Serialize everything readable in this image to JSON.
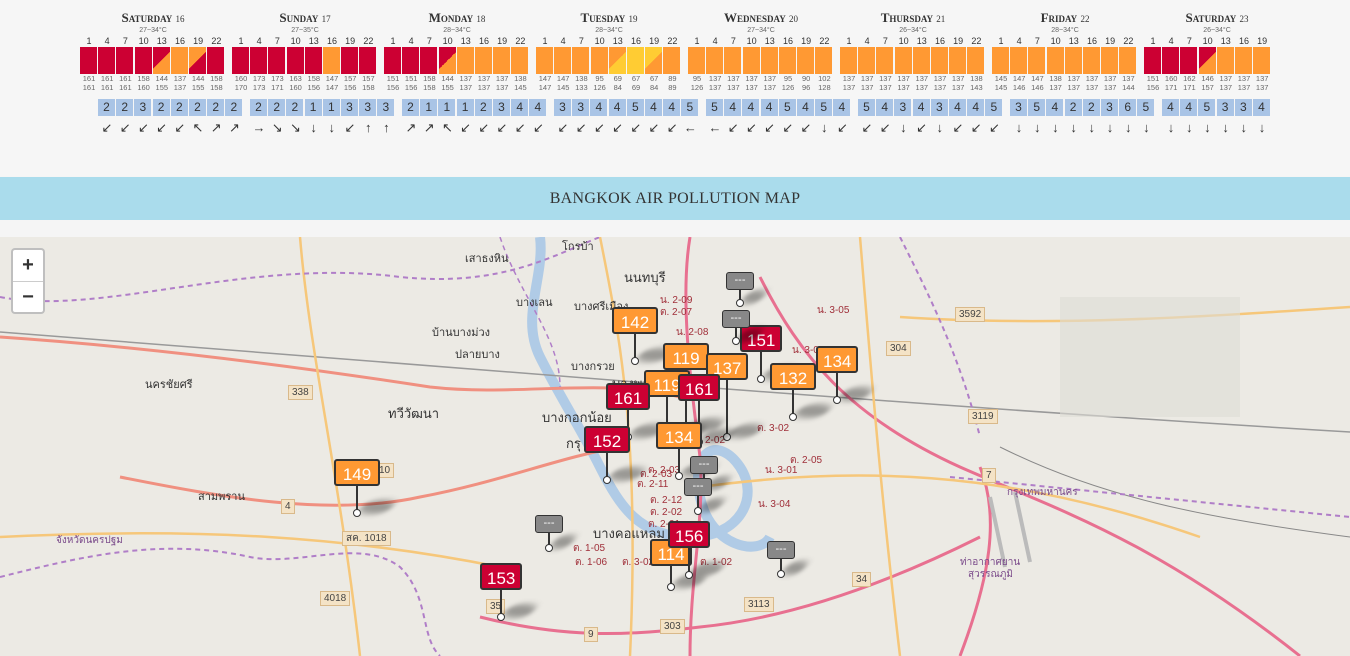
{
  "colors": {
    "red": "#cc0033",
    "orange": "#ff9933",
    "yellow": "#ffcc33",
    "gray": "#888888"
  },
  "forecast": [
    {
      "name": "Saturday",
      "num": "16",
      "temp": "27~34°C",
      "hours": [
        "1",
        "4",
        "7",
        "10",
        "13",
        "16",
        "19",
        "22"
      ],
      "cells": [
        "r",
        "r",
        "r",
        "r",
        "ro",
        "o",
        "or",
        "r"
      ],
      "v1": [
        "161",
        "161",
        "161",
        "158",
        "144",
        "137",
        "144",
        "158"
      ],
      "v2": [
        "161",
        "161",
        "161",
        "160",
        "155",
        "137",
        "155",
        "158"
      ],
      "wind": [
        "2",
        "2",
        "3",
        "2",
        "2",
        "2",
        "2",
        "2"
      ],
      "dir": [
        "↙",
        "↙",
        "↙",
        "↙",
        "↙",
        "↖",
        "↗",
        "↗"
      ]
    },
    {
      "name": "Sunday",
      "num": "17",
      "temp": "27~35°C",
      "hours": [
        "1",
        "4",
        "7",
        "10",
        "13",
        "16",
        "19",
        "22"
      ],
      "cells": [
        "r",
        "r",
        "r",
        "r",
        "r",
        "o",
        "r",
        "r"
      ],
      "v1": [
        "160",
        "173",
        "173",
        "163",
        "158",
        "147",
        "157",
        "157"
      ],
      "v2": [
        "170",
        "173",
        "171",
        "160",
        "156",
        "147",
        "156",
        "158"
      ],
      "wind": [
        "2",
        "2",
        "2",
        "1",
        "1",
        "3",
        "3",
        "3"
      ],
      "dir": [
        "→",
        "↘",
        "↘",
        "↓",
        "↓",
        "↙",
        "↑",
        "↑"
      ]
    },
    {
      "name": "Monday",
      "num": "18",
      "temp": "28~34°C",
      "hours": [
        "1",
        "4",
        "7",
        "10",
        "13",
        "16",
        "19",
        "22"
      ],
      "cells": [
        "r",
        "r",
        "r",
        "ro",
        "o",
        "o",
        "o",
        "o"
      ],
      "v1": [
        "151",
        "151",
        "158",
        "144",
        "137",
        "137",
        "137",
        "138"
      ],
      "v2": [
        "156",
        "156",
        "158",
        "155",
        "137",
        "137",
        "137",
        "145"
      ],
      "wind": [
        "2",
        "1",
        "1",
        "1",
        "2",
        "3",
        "4",
        "4"
      ],
      "dir": [
        "↗",
        "↗",
        "↖",
        "↙",
        "↙",
        "↙",
        "↙",
        "↙"
      ]
    },
    {
      "name": "Tuesday",
      "num": "19",
      "temp": "28~34°C",
      "hours": [
        "1",
        "4",
        "7",
        "10",
        "13",
        "16",
        "19",
        "22"
      ],
      "cells": [
        "o",
        "o",
        "o",
        "o",
        "oy",
        "y",
        "yo",
        "o"
      ],
      "v1": [
        "147",
        "147",
        "138",
        "95",
        "69",
        "67",
        "67",
        "89"
      ],
      "v2": [
        "147",
        "145",
        "133",
        "126",
        "84",
        "69",
        "84",
        "89"
      ],
      "wind": [
        "3",
        "3",
        "4",
        "4",
        "5",
        "4",
        "4",
        "5"
      ],
      "dir": [
        "↙",
        "↙",
        "↙",
        "↙",
        "↙",
        "↙",
        "↙",
        "←"
      ]
    },
    {
      "name": "Wednesday",
      "num": "20",
      "temp": "27~34°C",
      "hours": [
        "1",
        "4",
        "7",
        "10",
        "13",
        "16",
        "19",
        "22"
      ],
      "cells": [
        "o",
        "o",
        "o",
        "o",
        "o",
        "o",
        "o",
        "o"
      ],
      "v1": [
        "95",
        "137",
        "137",
        "137",
        "137",
        "95",
        "90",
        "102"
      ],
      "v2": [
        "126",
        "137",
        "137",
        "137",
        "137",
        "126",
        "96",
        "128"
      ],
      "wind": [
        "5",
        "4",
        "4",
        "4",
        "5",
        "4",
        "5",
        "4"
      ],
      "dir": [
        "←",
        "↙",
        "↙",
        "↙",
        "↙",
        "↙",
        "↓",
        "↙"
      ]
    },
    {
      "name": "Thursday",
      "num": "21",
      "temp": "26~34°C",
      "hours": [
        "1",
        "4",
        "7",
        "10",
        "13",
        "16",
        "19",
        "22"
      ],
      "cells": [
        "o",
        "o",
        "o",
        "o",
        "o",
        "o",
        "o",
        "o"
      ],
      "v1": [
        "137",
        "137",
        "137",
        "137",
        "137",
        "137",
        "137",
        "138"
      ],
      "v2": [
        "137",
        "137",
        "137",
        "137",
        "137",
        "137",
        "137",
        "143"
      ],
      "wind": [
        "5",
        "4",
        "3",
        "4",
        "3",
        "4",
        "4",
        "5"
      ],
      "dir": [
        "↙",
        "↙",
        "↓",
        "↙",
        "↓",
        "↙",
        "↙",
        "↙"
      ]
    },
    {
      "name": "Friday",
      "num": "22",
      "temp": "28~34°C",
      "hours": [
        "1",
        "4",
        "7",
        "10",
        "13",
        "16",
        "19",
        "22"
      ],
      "cells": [
        "o",
        "o",
        "o",
        "o",
        "o",
        "o",
        "o",
        "o"
      ],
      "v1": [
        "145",
        "147",
        "147",
        "138",
        "137",
        "137",
        "137",
        "137"
      ],
      "v2": [
        "145",
        "146",
        "146",
        "137",
        "137",
        "137",
        "137",
        "144"
      ],
      "wind": [
        "3",
        "5",
        "4",
        "2",
        "2",
        "3",
        "6",
        "5"
      ],
      "dir": [
        "↓",
        "↓",
        "↓",
        "↓",
        "↓",
        "↓",
        "↓",
        "↓"
      ]
    },
    {
      "name": "Saturday",
      "num": "23",
      "temp": "26~34°C",
      "hours": [
        "1",
        "4",
        "7",
        "10",
        "13",
        "16",
        "19"
      ],
      "cells": [
        "r",
        "r",
        "r",
        "ro",
        "o",
        "o",
        "o"
      ],
      "v1": [
        "151",
        "160",
        "162",
        "146",
        "137",
        "137",
        "137"
      ],
      "v2": [
        "156",
        "171",
        "171",
        "157",
        "137",
        "137",
        "137"
      ],
      "wind": [
        "4",
        "4",
        "5",
        "3",
        "3",
        "4"
      ],
      "dir": [
        "↓",
        "↓",
        "↓",
        "↓",
        "↓",
        "↓"
      ]
    }
  ],
  "banner": "BANGKOK AIR POLLUTION MAP",
  "zoom": {
    "plus": "+",
    "minus": "−"
  },
  "places": [
    {
      "t": "โกรบ้า",
      "c": ""
    },
    {
      "t": "เสาธงหิน",
      "c": ""
    },
    {
      "t": "นนทบุรี",
      "c": "big"
    },
    {
      "t": "บางเลน",
      "c": ""
    },
    {
      "t": "บางศรีเมือง",
      "c": ""
    },
    {
      "t": "บ้านบางม่วง",
      "c": ""
    },
    {
      "t": "ปลายบาง",
      "c": ""
    },
    {
      "t": "บางกรวย",
      "c": ""
    },
    {
      "t": "นครชัยศรี",
      "c": ""
    },
    {
      "t": "ทวีวัฒนา",
      "c": "big"
    },
    {
      "t": "บางพลั",
      "c": "big"
    },
    {
      "t": "บางกอกน้อย",
      "c": "big"
    },
    {
      "t": "กรุ",
      "c": "big"
    },
    {
      "t": "สามพราน",
      "c": ""
    },
    {
      "t": "บางคอแหลม",
      "c": "big"
    },
    {
      "t": "กรุงเทพมหานคร",
      "c": "purple"
    },
    {
      "t": "ท่าอากาศยาน",
      "c": "purple"
    },
    {
      "t": "สุวรรณภูมิ",
      "c": "purple"
    },
    {
      "t": "จังหวัดนครปฐม",
      "c": "purple"
    },
    {
      "t": "น. 2-09",
      "c": "red"
    },
    {
      "t": "ต. 2-07",
      "c": "red"
    },
    {
      "t": "น. 2-08",
      "c": "red"
    },
    {
      "t": "น. 3-05",
      "c": "red"
    },
    {
      "t": "น. 3-04",
      "c": "red"
    },
    {
      "t": "ต. 3-02",
      "c": "red"
    },
    {
      "t": "2-02",
      "c": "red"
    },
    {
      "t": "ต. 2-03",
      "c": "red"
    },
    {
      "t": "ต. 2-05",
      "c": "red"
    },
    {
      "t": "น. 3-01",
      "c": "red"
    },
    {
      "t": "ต. 2-03",
      "c": "red"
    },
    {
      "t": "ต. 2-11",
      "c": "red"
    },
    {
      "t": "ต. 2-12",
      "c": "red"
    },
    {
      "t": "ต. 2-02",
      "c": "red"
    },
    {
      "t": "ต. 2-01",
      "c": "red"
    },
    {
      "t": "น. 3-04",
      "c": "red"
    },
    {
      "t": "ต. 1-05",
      "c": "red"
    },
    {
      "t": "ต. 1-06",
      "c": "red"
    },
    {
      "t": "ต. 3-02",
      "c": "red"
    },
    {
      "t": "ต. 1-02",
      "c": "red"
    }
  ],
  "roads": [
    "3592",
    "304",
    "338",
    "3119",
    "7",
    "10",
    "4",
    "สค. 1018",
    "4018",
    "34",
    "3113",
    "303",
    "9",
    "35"
  ],
  "markers": [
    {
      "v": "142",
      "c": "orange"
    },
    {
      "v": "151",
      "c": "red"
    },
    {
      "v": "119",
      "c": "orange"
    },
    {
      "v": "137",
      "c": "orange"
    },
    {
      "v": "134",
      "c": "orange"
    },
    {
      "v": "132",
      "c": "orange"
    },
    {
      "v": "119",
      "c": "orange"
    },
    {
      "v": "161",
      "c": "red"
    },
    {
      "v": "161",
      "c": "red"
    },
    {
      "v": "134",
      "c": "orange"
    },
    {
      "v": "152",
      "c": "red"
    },
    {
      "v": "149",
      "c": "orange"
    },
    {
      "v": "114",
      "c": "orange"
    },
    {
      "v": "156",
      "c": "red"
    },
    {
      "v": "153",
      "c": "red"
    },
    {
      "v": "---",
      "c": "gray"
    },
    {
      "v": "---",
      "c": "gray"
    },
    {
      "v": "---",
      "c": "gray"
    },
    {
      "v": "---",
      "c": "gray"
    },
    {
      "v": "---",
      "c": "gray"
    },
    {
      "v": "---",
      "c": "gray"
    }
  ]
}
